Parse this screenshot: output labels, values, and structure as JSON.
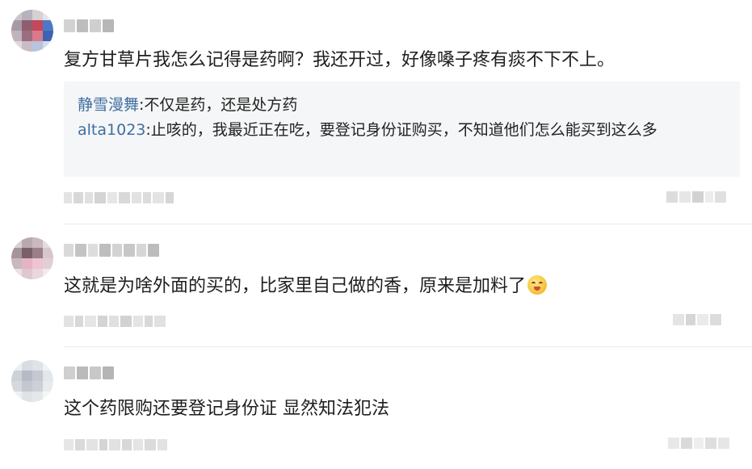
{
  "comments": [
    {
      "text": "复方甘草片我怎么记得是药啊？我还开过，好像嗓子疼有痰不下不上。",
      "replies": [
        {
          "user": "静雪漫舞",
          "text": ":不仅是药，还是处方药"
        },
        {
          "user": "alta1023",
          "text": ":止咳的，我最近正在吃，要登记身份证购买，不知道他们怎么能买到这么多"
        }
      ]
    },
    {
      "text": "这就是为啥外面的买的，比家里自己做的香，原来是加料了",
      "emoji": "smiling-face-emoji"
    },
    {
      "text": "这个药限购还要登记身份证 显然知法犯法"
    }
  ],
  "icons": {
    "emoji": "smiling-face-emoji"
  },
  "colors": {
    "reply_user": "#3f6fa1",
    "reply_background": "#f5f6f7",
    "divider": "#ececec"
  }
}
